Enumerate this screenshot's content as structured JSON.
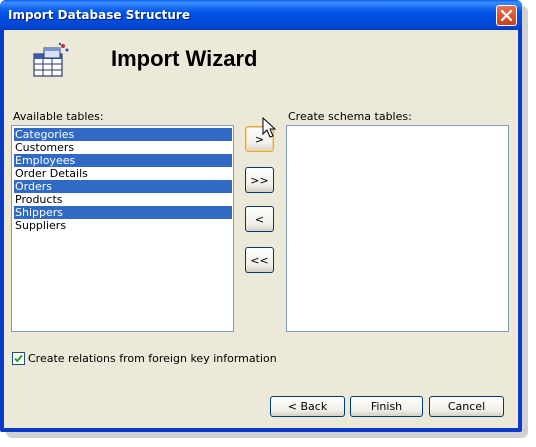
{
  "window": {
    "title": "Import Database Structure"
  },
  "wizard": {
    "title": "Import Wizard",
    "icon": "database-table-icon"
  },
  "available": {
    "label": "Available tables:",
    "items": [
      {
        "label": "Categories",
        "selected": true
      },
      {
        "label": "Customers",
        "selected": false
      },
      {
        "label": "Employees",
        "selected": true
      },
      {
        "label": "Order Details",
        "selected": false
      },
      {
        "label": "Orders",
        "selected": true
      },
      {
        "label": "Products",
        "selected": false
      },
      {
        "label": "Shippers",
        "selected": true
      },
      {
        "label": "Suppliers",
        "selected": false
      }
    ]
  },
  "schema": {
    "label": "Create schema tables:",
    "items": []
  },
  "transfer": {
    "add": ">",
    "add_all": ">>",
    "remove": "<",
    "remove_all": "<<"
  },
  "options": {
    "relations_label": "Create relations from foreign key information",
    "relations_checked": true
  },
  "footer": {
    "back": "< Back",
    "finish": "Finish",
    "cancel": "Cancel"
  },
  "colors": {
    "selection": "#316ac5",
    "titlebar": "#0055e5",
    "dialog": "#ece9d8"
  }
}
